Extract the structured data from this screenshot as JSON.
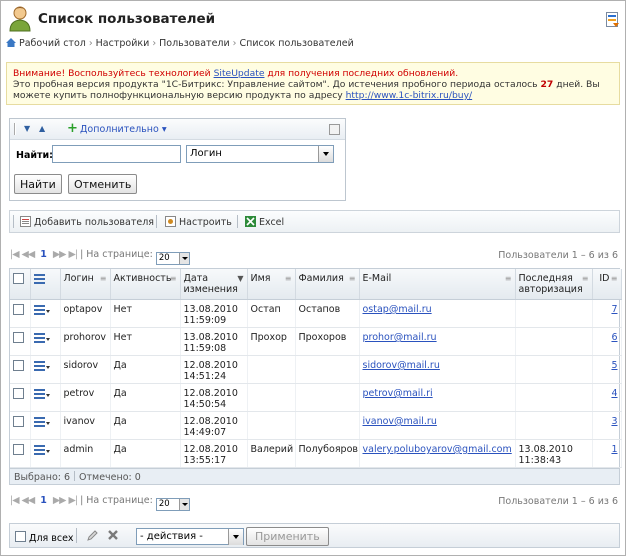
{
  "header": {
    "title": "Список пользователей"
  },
  "breadcrumb": [
    "Рабочий стол",
    "Настройки",
    "Пользователи",
    "Список пользователей"
  ],
  "warning": {
    "line1_before": "Внимание! Воспользуйтесь технологией ",
    "line1_link": "SiteUpdate",
    "line1_after": " для получения последних обновлений.",
    "line2_before": "Это пробная версия продукта \"1С-Битрикс: Управление сайтом\". До истечения пробного периода осталось ",
    "days": "27",
    "line2_after": " дней. Вы",
    "line3_before": "можете купить полнофункциональную версию продукта по адресу ",
    "line3_link": "http://www.1c-bitrix.ru/buy/"
  },
  "filter": {
    "more_label": "Дополнительно",
    "find_label": "Найти:",
    "find_value": "",
    "field_select": "Логин",
    "find_button": "Найти",
    "cancel_button": "Отменить"
  },
  "toolbar": {
    "add_user": "Добавить пользователя",
    "configure": "Настроить",
    "excel": "Excel"
  },
  "pager": {
    "current_page": "1",
    "per_page_label": "| На странице:",
    "per_page": "20",
    "info": "Пользователи 1 – 6 из 6"
  },
  "columns": [
    "Логин",
    "Активность",
    "Дата изменения",
    "Имя",
    "Фамилия",
    "E-Mail",
    "Последняя авторизация",
    "ID"
  ],
  "rows": [
    {
      "login": "optapov",
      "active": "Нет",
      "date": "13.08.2010",
      "time": "11:59:09",
      "name": "Остап",
      "surname": "Остапов",
      "email": "ostap@mail.ru",
      "last_date": "",
      "last_time": "",
      "id": "7"
    },
    {
      "login": "prohorov",
      "active": "Нет",
      "date": "13.08.2010",
      "time": "11:59:08",
      "name": "Прохор",
      "surname": "Прохоров",
      "email": "prohor@mail.ru",
      "last_date": "",
      "last_time": "",
      "id": "6"
    },
    {
      "login": "sidorov",
      "active": "Да",
      "date": "12.08.2010",
      "time": "14:51:24",
      "name": "",
      "surname": "",
      "email": "sidorov@mail.ru",
      "last_date": "",
      "last_time": "",
      "id": "5"
    },
    {
      "login": "petrov",
      "active": "Да",
      "date": "12.08.2010",
      "time": "14:50:54",
      "name": "",
      "surname": "",
      "email": "petrov@mail.ri",
      "last_date": "",
      "last_time": "",
      "id": "4"
    },
    {
      "login": "ivanov",
      "active": "Да",
      "date": "12.08.2010",
      "time": "14:49:07",
      "name": "",
      "surname": "",
      "email": "ivanov@mail.ru",
      "last_date": "",
      "last_time": "",
      "id": "3"
    },
    {
      "login": "admin",
      "active": "Да",
      "date": "12.08.2010",
      "time": "13:55:17",
      "name": "Валерий",
      "surname": "Полубояров",
      "email": "valery.poluboyarov@gmail.com",
      "last_date": "13.08.2010",
      "last_time": "11:38:43",
      "id": "1"
    }
  ],
  "footer": {
    "selected": "Выбрано: 6",
    "checked": "Отмечено: 0"
  },
  "actions": {
    "for_all": "Для всех",
    "select": "- действия -",
    "apply": "Применить"
  }
}
